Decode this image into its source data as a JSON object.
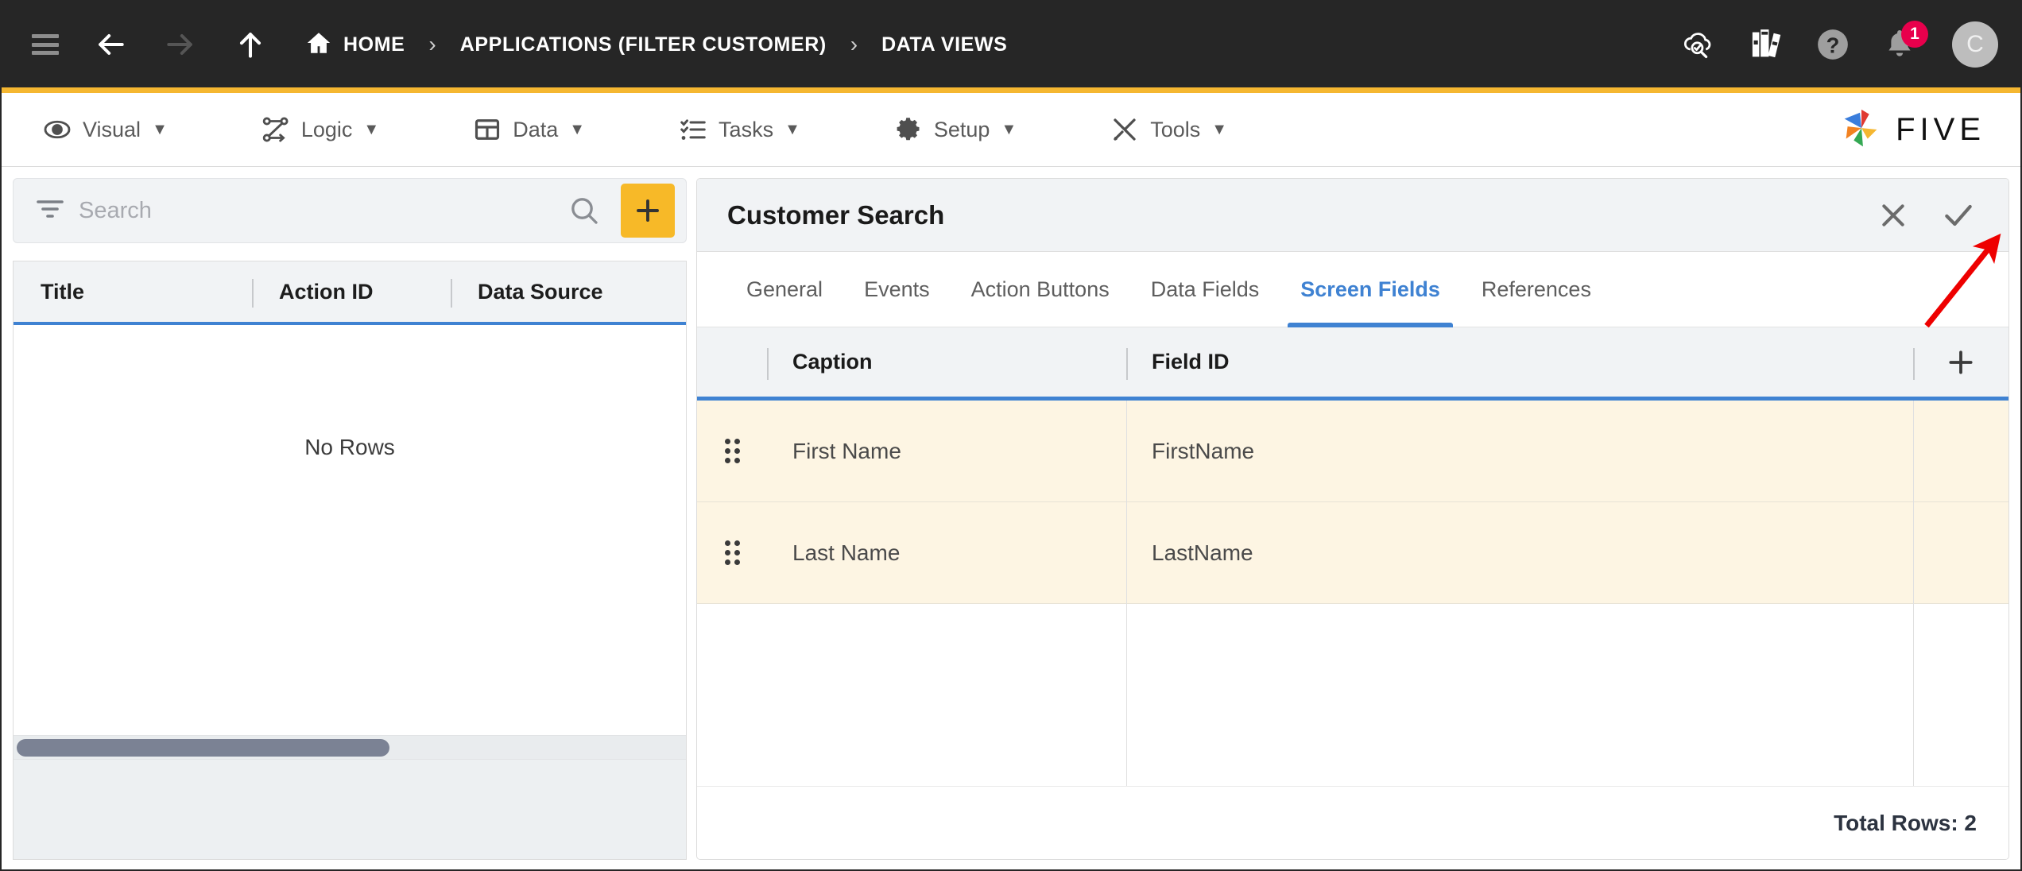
{
  "topbar": {
    "menu_icon": "hamburger-icon",
    "back_icon": "arrow-left-icon",
    "forward_icon": "arrow-right-icon",
    "up_icon": "arrow-up-icon",
    "breadcrumbs": [
      {
        "label": "HOME",
        "icon": "home-icon"
      },
      {
        "label": "APPLICATIONS (FILTER CUSTOMER)",
        "icon": ""
      },
      {
        "label": "DATA VIEWS",
        "icon": ""
      }
    ],
    "separator": "›",
    "actions": [
      {
        "name": "cloud-search-icon",
        "label": ""
      },
      {
        "name": "library-icon",
        "label": ""
      },
      {
        "name": "help-icon",
        "label": ""
      },
      {
        "name": "notifications-icon",
        "label": "",
        "badge": "1"
      }
    ],
    "avatar_initial": "C",
    "badge_color": "#e8004c",
    "accent_underline": "#f5b731"
  },
  "menubar": {
    "items": [
      {
        "label": "Visual",
        "icon": "eye-icon",
        "caret": "▼"
      },
      {
        "label": "Logic",
        "icon": "logic-flow-icon",
        "caret": "▼"
      },
      {
        "label": "Data",
        "icon": "table-grid-icon",
        "caret": "▼"
      },
      {
        "label": "Tasks",
        "icon": "checklist-icon",
        "caret": "▼"
      },
      {
        "label": "Setup",
        "icon": "gear-icon",
        "caret": "▼"
      },
      {
        "label": "Tools",
        "icon": "tools-icon",
        "caret": "▼"
      }
    ],
    "logo_text": "FIVE"
  },
  "left_panel": {
    "search": {
      "placeholder": "Search",
      "value": "",
      "filter_icon": "filter-icon",
      "search_icon": "search-icon",
      "add_icon": "plus-icon",
      "add_button_color": "#f7b928"
    },
    "grid": {
      "columns": [
        "Title",
        "Action ID",
        "Data Source"
      ],
      "rows": [],
      "empty_message": "No Rows",
      "header_accent": "#3f82d2"
    }
  },
  "right_panel": {
    "title": "Customer Search",
    "close_icon": "close-icon",
    "confirm_icon": "check-icon",
    "tabs": [
      {
        "label": "General",
        "active": false
      },
      {
        "label": "Events",
        "active": false
      },
      {
        "label": "Action Buttons",
        "active": false
      },
      {
        "label": "Data Fields",
        "active": false
      },
      {
        "label": "Screen Fields",
        "active": true
      },
      {
        "label": "References",
        "active": false
      }
    ],
    "active_tab_color": "#3f82d2",
    "grid": {
      "columns": [
        "Caption",
        "Field ID"
      ],
      "add_icon": "plus-icon",
      "row_background": "#fdf5e3",
      "rows": [
        {
          "handle": "drag-handle-icon",
          "caption": "First Name",
          "field_id": "FirstName"
        },
        {
          "handle": "drag-handle-icon",
          "caption": "Last Name",
          "field_id": "LastName"
        }
      ],
      "footer": "Total Rows: 2"
    }
  },
  "annotation": {
    "arrow": "red-annotation-arrow",
    "color": "#ee0000",
    "points_at": "check-icon"
  }
}
